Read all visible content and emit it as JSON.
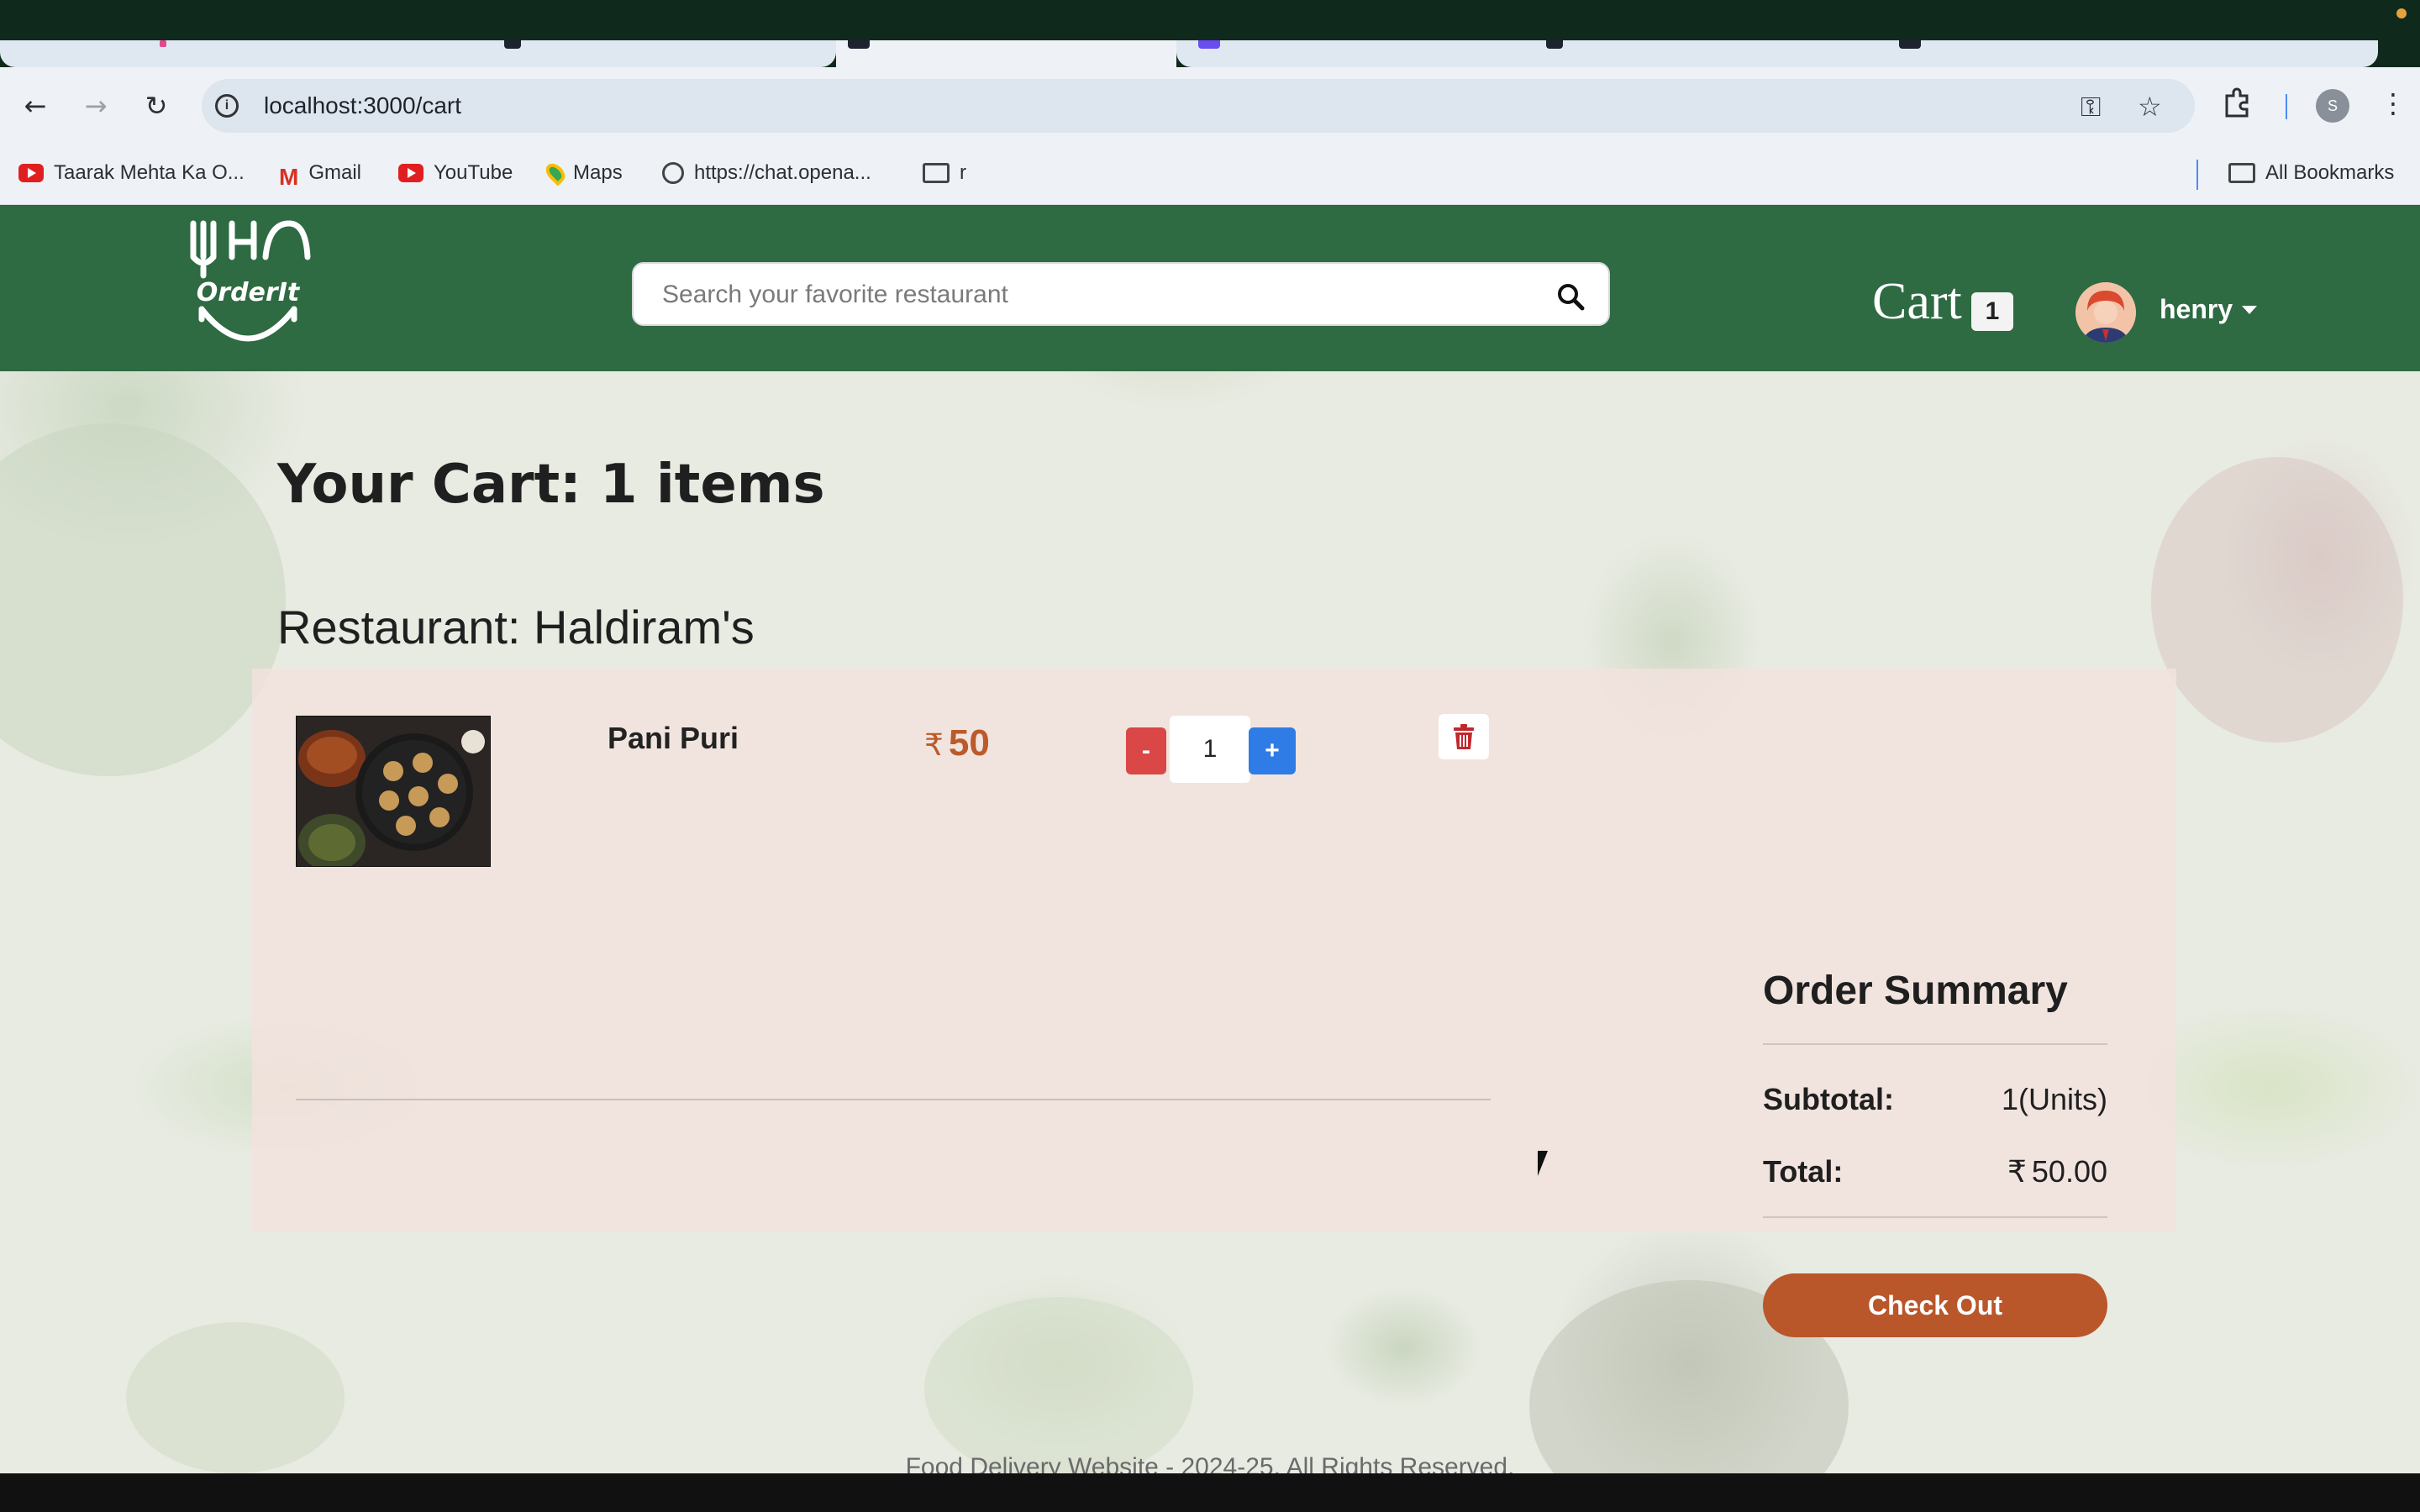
{
  "browser": {
    "url": "localhost:3000/cart",
    "bookmarks": [
      {
        "label": "Taarak Mehta Ka O...",
        "icon": "youtube-icon"
      },
      {
        "label": "Gmail",
        "icon": "gmail-icon"
      },
      {
        "label": "YouTube",
        "icon": "youtube-icon"
      },
      {
        "label": "Maps",
        "icon": "maps-icon"
      },
      {
        "label": "https://chat.opena...",
        "icon": "openai-icon"
      },
      {
        "label": "r",
        "icon": "folder-icon"
      }
    ],
    "all_bookmarks": "All Bookmarks",
    "profile_initial": "S"
  },
  "header": {
    "logo_text": "OrderIt",
    "search_placeholder": "Search your favorite restaurant",
    "cart_label": "Cart",
    "cart_count": "1",
    "user_name": "henry"
  },
  "cart": {
    "title": "Your Cart: 1 items",
    "restaurant": "Restaurant: Haldiram's",
    "items": [
      {
        "name": "Pani Puri",
        "currency": "₹",
        "price": "50",
        "quantity": "1"
      }
    ],
    "minus_label": "-",
    "plus_label": "+"
  },
  "summary": {
    "title": "Order Summary",
    "subtotal_label": "Subtotal:",
    "subtotal_value": "1(Units)",
    "total_label": "Total:",
    "total_currency": "₹",
    "total_value": "50.00",
    "checkout_label": "Check Out"
  },
  "footer": {
    "text": "Food Delivery Website - 2024-25, All Rights Reserved."
  },
  "colors": {
    "header_green": "#2e6a42",
    "price_orange": "#bb5a2b",
    "checkout_orange": "#b9562a",
    "minus_red": "#d94747",
    "plus_blue": "#2f7ce6"
  }
}
